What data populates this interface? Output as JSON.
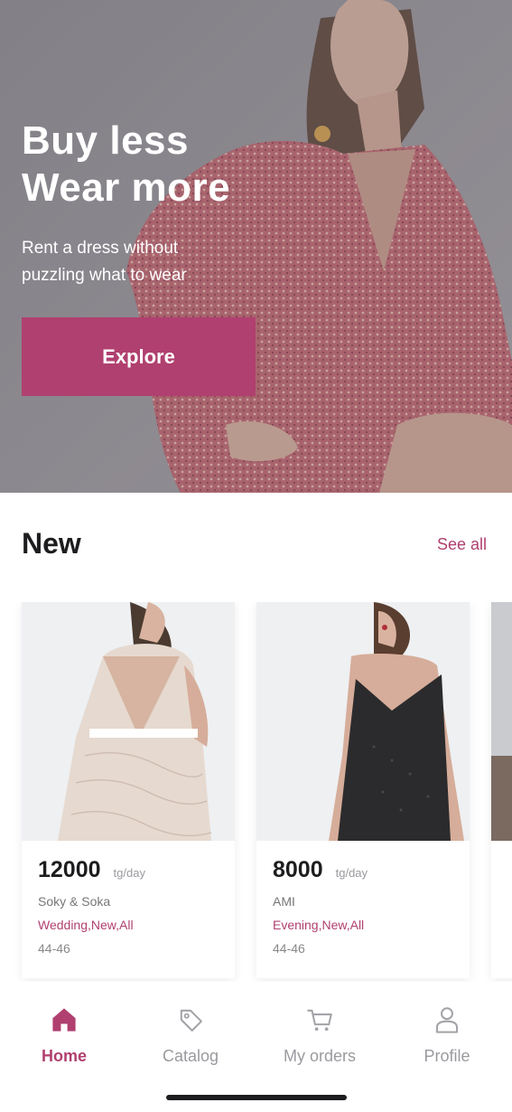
{
  "hero": {
    "title": "Buy less\nWear more",
    "subtitle": "Rent a dress without\npuzzling what to wear",
    "cta_label": "Explore"
  },
  "new_section": {
    "title": "New",
    "see_all_label": "See all",
    "products": [
      {
        "price": "12000",
        "unit": "tg/day",
        "brand": "Soky & Soka",
        "tags": "Wedding,New,All",
        "sizes": "44-46"
      },
      {
        "price": "8000",
        "unit": "tg/day",
        "brand": "AMI",
        "tags": "Evening,New,All",
        "sizes": "44-46"
      }
    ]
  },
  "tabbar": {
    "items": [
      {
        "label": "Home",
        "icon": "home-icon",
        "active": true
      },
      {
        "label": "Catalog",
        "icon": "tag-icon",
        "active": false
      },
      {
        "label": "My orders",
        "icon": "cart-icon",
        "active": false
      },
      {
        "label": "Profile",
        "icon": "user-icon",
        "active": false
      }
    ]
  },
  "colors": {
    "accent": "#b0406f",
    "text": "#1d1d1f",
    "muted": "#9a9a9f"
  }
}
